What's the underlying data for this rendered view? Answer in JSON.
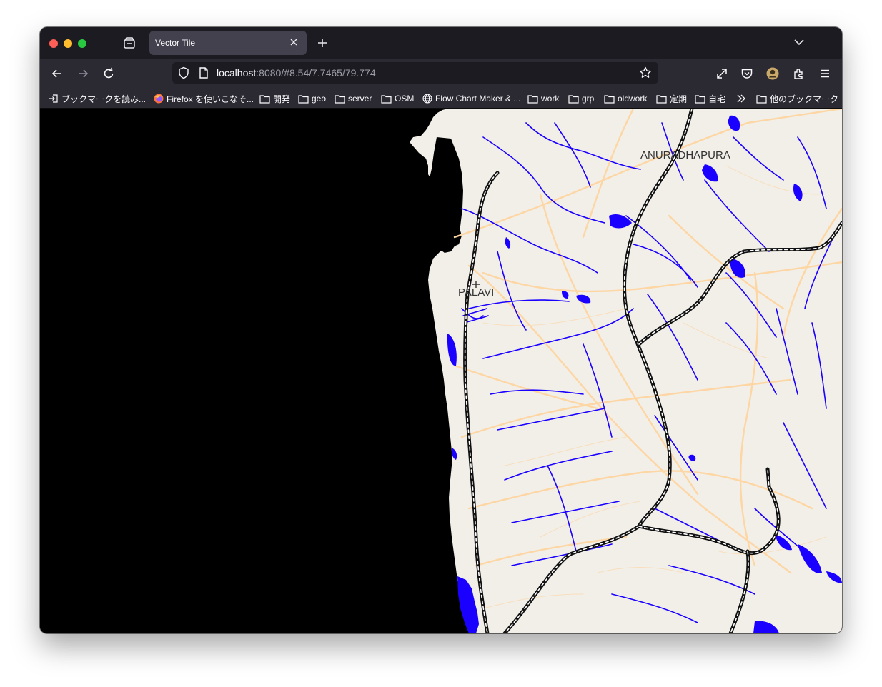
{
  "window": {
    "tab_title": "Vector Tile",
    "url_host": "localhost",
    "url_rest": ":8080/#8.54/7.7465/79.774"
  },
  "toolbar": {
    "icons": [
      "back-icon",
      "forward-icon",
      "reload-icon",
      "shield-icon",
      "page-icon",
      "star-icon",
      "fullscreen-icon",
      "pocket-icon",
      "account-icon",
      "extensions-icon",
      "menu-icon"
    ]
  },
  "bookmarks": [
    {
      "label": "ブックマークを読み...",
      "icon": "import-icon"
    },
    {
      "label": "Firefox を使いこなそ...",
      "icon": "firefox-icon"
    },
    {
      "label": "開発",
      "icon": "folder-icon"
    },
    {
      "label": "geo",
      "icon": "folder-icon"
    },
    {
      "label": "server",
      "icon": "folder-icon"
    },
    {
      "label": "OSM",
      "icon": "folder-icon"
    },
    {
      "label": "Flow Chart Maker & ...",
      "icon": "globe-icon"
    },
    {
      "label": "work",
      "icon": "folder-icon"
    },
    {
      "label": "grp",
      "icon": "folder-icon"
    },
    {
      "label": "oldwork",
      "icon": "folder-icon"
    },
    {
      "label": "定期",
      "icon": "folder-icon"
    },
    {
      "label": "自宅",
      "icon": "folder-icon"
    }
  ],
  "bookmarks_other": "他のブックマーク",
  "map": {
    "labels": {
      "anuradhapura": "ANURADHAPURA",
      "palavi": "PALAVI"
    },
    "colors": {
      "land": "#f2efe9",
      "sea": "#000000",
      "water": "#1a00ff",
      "road": "#fdd6a4",
      "rail": "#111111"
    }
  }
}
